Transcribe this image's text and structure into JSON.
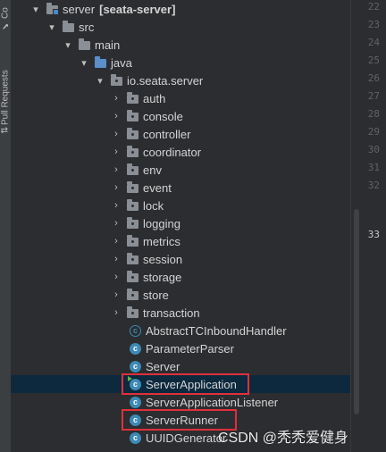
{
  "side_tabs": [
    "Co",
    "Pull Requests"
  ],
  "root": {
    "label": "server",
    "module": "[seata-server]"
  },
  "folders": {
    "src": "src",
    "main": "main",
    "java": "java",
    "package": "io.seata.server"
  },
  "subpackages": [
    "auth",
    "console",
    "controller",
    "coordinator",
    "env",
    "event",
    "lock",
    "logging",
    "metrics",
    "session",
    "storage",
    "store",
    "transaction"
  ],
  "classes": [
    "AbstractTCInboundHandler",
    "ParameterParser",
    "Server",
    "ServerApplication",
    "ServerApplicationListener",
    "ServerRunner",
    "UUIDGenerator"
  ],
  "class_icon_letter": "c",
  "selected_class": "ServerApplication",
  "line_numbers": [
    "22",
    "23",
    "24",
    "25",
    "26",
    "27",
    "28",
    "29",
    "30",
    "31",
    "32",
    "33"
  ],
  "current_line": "33",
  "watermark": "CSDN @秃秃爱健身",
  "colors": {
    "selection": "#0d293e",
    "highlight_box": "#e0303b",
    "class_icon": "#3d8ab5",
    "folder_blue": "#5a8fc9"
  }
}
